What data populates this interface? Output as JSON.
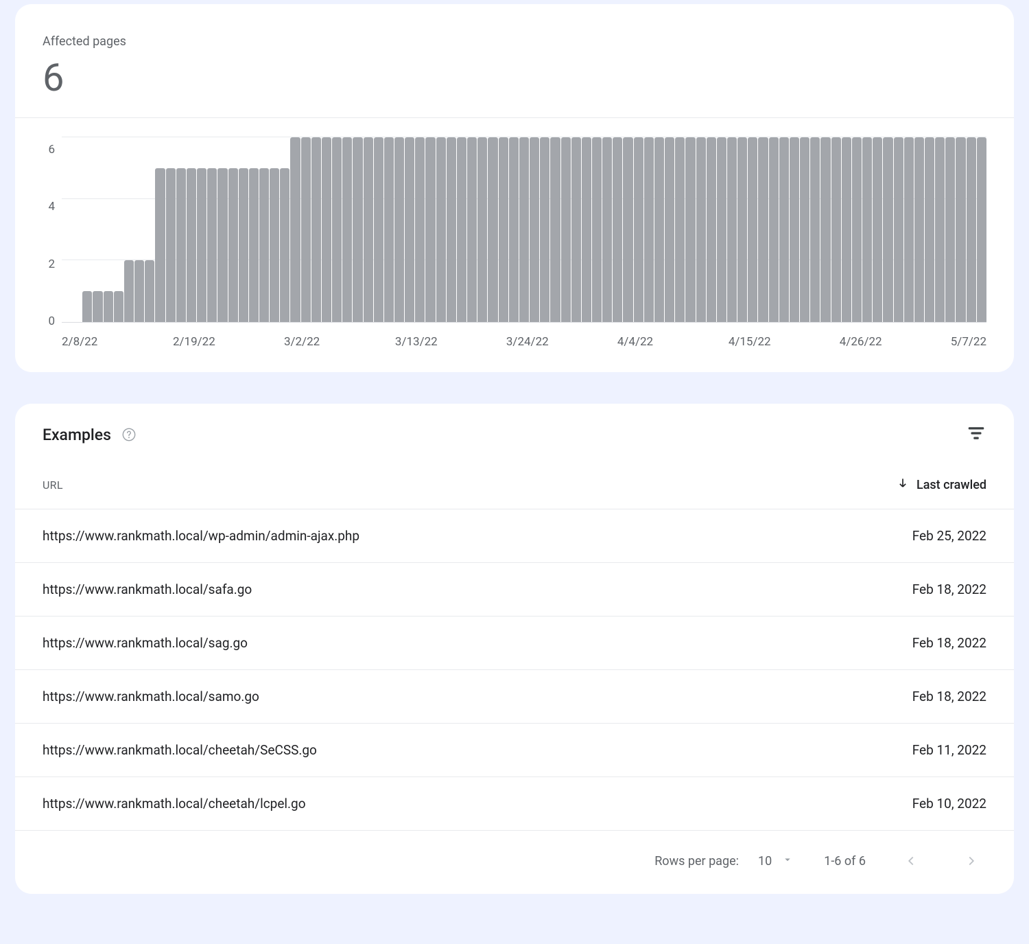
{
  "summary": {
    "label": "Affected pages",
    "value": "6"
  },
  "chart_data": {
    "type": "bar",
    "title": "",
    "xlabel": "",
    "ylabel": "",
    "ylim": [
      0,
      6
    ],
    "y_ticks": [
      "6",
      "4",
      "2",
      "0"
    ],
    "x_ticks": [
      "2/8/22",
      "2/19/22",
      "3/2/22",
      "3/13/22",
      "3/24/22",
      "4/4/22",
      "4/15/22",
      "4/26/22",
      "5/7/22"
    ],
    "categories_start": "2022-02-08",
    "categories_end": "2022-05-07",
    "values": [
      0,
      0,
      1,
      1,
      1,
      1,
      2,
      2,
      2,
      5,
      5,
      5,
      5,
      5,
      5,
      5,
      5,
      5,
      5,
      5,
      5,
      5,
      6,
      6,
      6,
      6,
      6,
      6,
      6,
      6,
      6,
      6,
      6,
      6,
      6,
      6,
      6,
      6,
      6,
      6,
      6,
      6,
      6,
      6,
      6,
      6,
      6,
      6,
      6,
      6,
      6,
      6,
      6,
      6,
      6,
      6,
      6,
      6,
      6,
      6,
      6,
      6,
      6,
      6,
      6,
      6,
      6,
      6,
      6,
      6,
      6,
      6,
      6,
      6,
      6,
      6,
      6,
      6,
      6,
      6,
      6,
      6,
      6,
      6,
      6,
      6,
      6,
      6,
      6
    ]
  },
  "examples": {
    "title": "Examples",
    "columns": {
      "url": "URL",
      "last_crawled": "Last crawled"
    },
    "rows": [
      {
        "url": "https://www.rankmath.local/wp-admin/admin-ajax.php",
        "date": "Feb 25, 2022"
      },
      {
        "url": "https://www.rankmath.local/safa.go",
        "date": "Feb 18, 2022"
      },
      {
        "url": "https://www.rankmath.local/sag.go",
        "date": "Feb 18, 2022"
      },
      {
        "url": "https://www.rankmath.local/samo.go",
        "date": "Feb 18, 2022"
      },
      {
        "url": "https://www.rankmath.local/cheetah/SeCSS.go",
        "date": "Feb 11, 2022"
      },
      {
        "url": "https://www.rankmath.local/cheetah/lcpel.go",
        "date": "Feb 10, 2022"
      }
    ]
  },
  "pagination": {
    "rows_per_page_label": "Rows per page:",
    "rows_per_page_value": "10",
    "range": "1-6 of 6"
  }
}
